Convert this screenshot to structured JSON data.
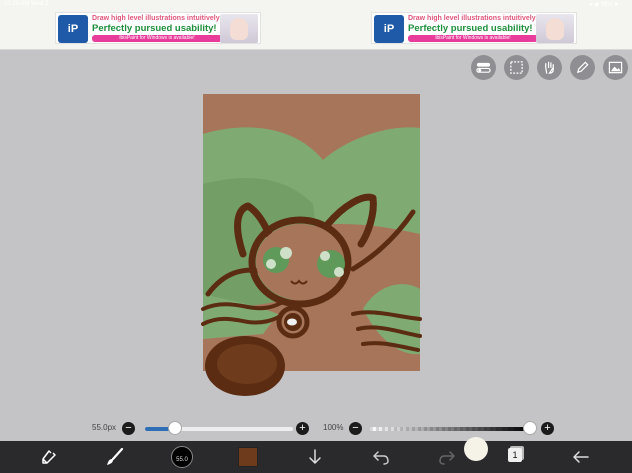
{
  "status": {
    "time": "10:29 AM  Wed 2",
    "right": "● ◆ 99% ■"
  },
  "ads": [
    {
      "logo": "iP",
      "line1": "Draw high level illustrations intuitively!",
      "line2": "Perfectly pursued usability!",
      "line3": "ibisPaint for Windows is available!"
    },
    {
      "logo": "iP",
      "line1": "Draw high level illustrations intuitively!",
      "line2": "Perfectly pursued usability!",
      "line3": "ibisPaint for Windows is available!"
    }
  ],
  "toolbar": {
    "icons": [
      "toggle-icon",
      "selection-icon",
      "hand-icon",
      "pencil-edit-icon",
      "image-icon"
    ]
  },
  "brush": {
    "size_label": "55.0px",
    "size_fraction": 0.2,
    "opacity_label": "100%",
    "opacity_fraction": 1.0,
    "minus": "−",
    "plus": "+",
    "preview_text": "55.0"
  },
  "colors": {
    "current": "#6e3c1c",
    "canvas_bg": "#a7765a",
    "hill_green": "#7fab73",
    "dark_brown": "#5b2c12",
    "eye_green": "#5f9a5a",
    "bottombar": "#2a2a2c"
  },
  "layers": {
    "count": "1"
  },
  "bottombar_icons": [
    "transform-icon",
    "brush-icon",
    "brush-size-preview",
    "color-swatch",
    "download-arrow-icon",
    "undo-icon",
    "redo-icon",
    "layers-icon",
    "back-arrow-icon"
  ]
}
